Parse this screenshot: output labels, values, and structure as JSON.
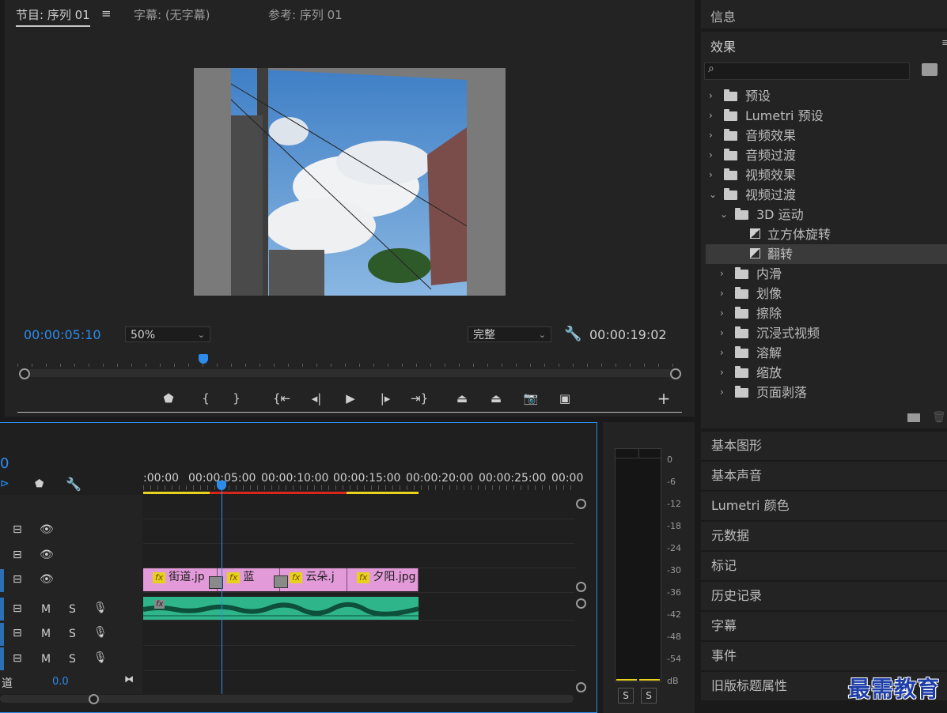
{
  "program_monitor": {
    "tabs": [
      "节目: 序列 01",
      "字幕: (无字幕)",
      "参考: 序列 01"
    ],
    "menu_icon": "hamburger-icon",
    "current_time": "00:00:05:10",
    "zoom": "50%",
    "quality": "完整",
    "duration": "00:00:19:02",
    "playhead_fraction": 0.273
  },
  "right_panel": {
    "info_tab": "信息",
    "effects_title": "效果",
    "search_placeholder": "",
    "tree": [
      {
        "label": "预设",
        "level": 0,
        "expanded": false,
        "icon": "preset-folder-icon"
      },
      {
        "label": "Lumetri 预设",
        "level": 0,
        "expanded": false,
        "icon": "preset-folder-icon"
      },
      {
        "label": "音频效果",
        "level": 0,
        "expanded": false,
        "icon": "folder-icon"
      },
      {
        "label": "音频过渡",
        "level": 0,
        "expanded": false,
        "icon": "folder-icon"
      },
      {
        "label": "视频效果",
        "level": 0,
        "expanded": false,
        "icon": "folder-icon"
      },
      {
        "label": "视频过渡",
        "level": 0,
        "expanded": true,
        "icon": "folder-icon"
      },
      {
        "label": "3D 运动",
        "level": 1,
        "expanded": true,
        "icon": "folder-icon"
      },
      {
        "label": "立方体旋转",
        "level": 2,
        "icon": "transition-icon"
      },
      {
        "label": "翻转",
        "level": 2,
        "icon": "transition-icon",
        "selected": true
      },
      {
        "label": "内滑",
        "level": 1,
        "expanded": false,
        "icon": "folder-icon"
      },
      {
        "label": "划像",
        "level": 1,
        "expanded": false,
        "icon": "folder-icon"
      },
      {
        "label": "擦除",
        "level": 1,
        "expanded": false,
        "icon": "folder-icon"
      },
      {
        "label": "沉浸式视频",
        "level": 1,
        "expanded": false,
        "icon": "folder-icon"
      },
      {
        "label": "溶解",
        "level": 1,
        "expanded": false,
        "icon": "folder-icon"
      },
      {
        "label": "缩放",
        "level": 1,
        "expanded": false,
        "icon": "folder-icon"
      },
      {
        "label": "页面剥落",
        "level": 1,
        "expanded": false,
        "icon": "folder-icon"
      }
    ],
    "side_panels": [
      "基本图形",
      "基本声音",
      "Lumetri 颜色",
      "元数据",
      "标记",
      "历史记录",
      "字幕",
      "事件",
      "旧版标题属性"
    ]
  },
  "timeline": {
    "timecode_partial": "0",
    "ruler_labels": [
      ":00:00",
      "00:00:05:00",
      "00:00:10:00",
      "00:00:15:00",
      "00:00:20:00",
      "00:00:25:00",
      "00:00"
    ],
    "tracks": [
      {
        "type": "video",
        "buttons": [
          "M",
          "S"
        ]
      },
      {
        "type": "audio",
        "m": "M",
        "s": "S"
      }
    ],
    "audio_m": "M",
    "audio_s": "S",
    "master_label": "道",
    "master_value": "0.0",
    "clips_video": [
      {
        "label": "街道.jp"
      },
      {
        "label": "蓝"
      },
      {
        "label": "云朵.j"
      },
      {
        "label": "夕阳.jpg"
      }
    ],
    "fx_badge": "fx"
  },
  "audio_meter": {
    "scale": [
      "0",
      "-6",
      "-12",
      "-18",
      "-24",
      "-30",
      "-36",
      "-42",
      "-48",
      "-54",
      "dB"
    ],
    "solo_buttons": [
      "S",
      "S"
    ]
  },
  "watermark": "最需教育",
  "colors": {
    "accent_blue": "#2d8ceb",
    "clip_video": "#e39ad9",
    "clip_audio": "#2fb58a",
    "work_area_yellow": "#e8d21e",
    "render_red": "#d8261c"
  }
}
